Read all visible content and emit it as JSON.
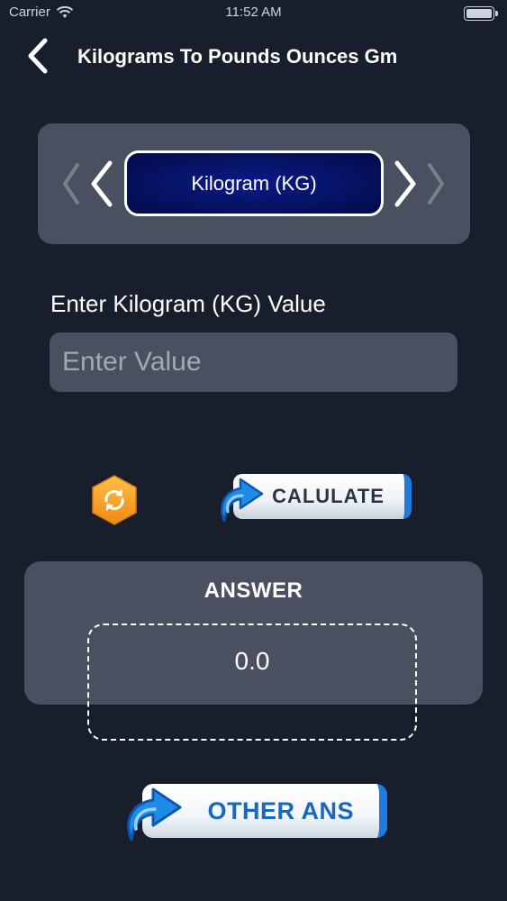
{
  "status_bar": {
    "carrier": "Carrier",
    "time": "11:52 AM"
  },
  "nav": {
    "title": "Kilograms To Pounds Ounces Gm"
  },
  "selector": {
    "unit": "Kilogram (KG)"
  },
  "input": {
    "label": "Enter Kilogram (KG) Value",
    "placeholder": "Enter Value",
    "value": ""
  },
  "actions": {
    "calculate_label": "CALULATE",
    "other_label": "OTHER ANS"
  },
  "answer": {
    "title": "ANSWER",
    "value": "0.0"
  },
  "colors": {
    "background": "#181e2b",
    "card": "#4a505f",
    "pill": "#05105a",
    "accent_blue": "#1f7ae0",
    "reset_orange": "#f5a623"
  },
  "icons": {
    "back": "chevron-left-icon",
    "prev": "chevron-left-icon",
    "next": "chevron-right-icon",
    "reset": "refresh-icon",
    "calculate": "curved-arrow-icon",
    "other": "curved-arrow-icon",
    "wifi": "wifi-icon",
    "battery": "battery-icon"
  }
}
